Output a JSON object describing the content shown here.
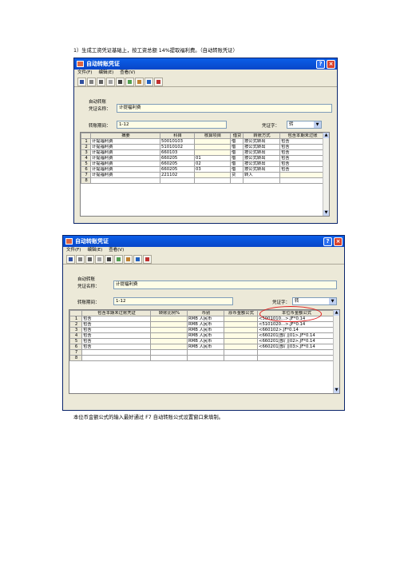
{
  "captions": {
    "top": "1）生成工资凭证基础上，按工资总额 14%提取福利费。（自动转账凭证）",
    "bottom": "本位币金额公式的输入最好通过 F7 自动转账公式设置窗口来填制。"
  },
  "window1": {
    "title": "自动转账凭证",
    "menu": [
      "文件(F)",
      "编辑(E)",
      "查看(V)"
    ],
    "auto_label": "自动转账",
    "voucher_name_label": "凭证名称：",
    "voucher_name": "计提福利费",
    "period_label": "转账期间：",
    "period": "1-12",
    "voucher_type_label": "凭证字：",
    "voucher_type": "转",
    "columns": [
      "",
      "摘要",
      "科目",
      "核算项目",
      "借贷",
      "转账方式",
      "包含本期未过账"
    ],
    "rows": [
      [
        "1",
        "计提福利费",
        "50010103",
        "",
        "借",
        "按公式转出",
        "包含"
      ],
      [
        "2",
        "计提福利费",
        "51010102",
        "",
        "借",
        "按公式转出",
        "包含"
      ],
      [
        "3",
        "计提福利费",
        "660103",
        "",
        "借",
        "按公式转出",
        "包含"
      ],
      [
        "4",
        "计提福利费",
        "660205",
        "01",
        "借",
        "按公式转出",
        "包含"
      ],
      [
        "5",
        "计提福利费",
        "660205",
        "02",
        "借",
        "按公式转出",
        "包含"
      ],
      [
        "6",
        "计提福利费",
        "660205",
        "03",
        "借",
        "按公式转出",
        "包含"
      ],
      [
        "7",
        "计提福利费",
        "221102",
        "",
        "贷",
        "转入",
        ""
      ],
      [
        "8",
        "",
        "",
        "",
        "",
        "",
        ""
      ]
    ]
  },
  "window2": {
    "title": "自动转账凭证",
    "menu": [
      "文件(F)",
      "编辑(E)",
      "查看(V)"
    ],
    "auto_label": "自动转账",
    "voucher_name_label": "凭证名称：",
    "voucher_name": "计提福利费",
    "period_label": "转账期间：",
    "period": "1-12",
    "voucher_type_label": "凭证字：",
    "voucher_type": "转",
    "columns": [
      "",
      "包含本期未过账凭证",
      "转账比例%",
      "币别",
      "原币金额公式",
      "本位币金额公式"
    ],
    "rows": [
      [
        "1",
        "包含",
        "",
        "RMB 人民币",
        "",
        "<5001010...>.JF*0.14"
      ],
      [
        "2",
        "包含",
        "",
        "RMB 人民币",
        "",
        "<5101020...>.JF*0.14"
      ],
      [
        "3",
        "包含",
        "",
        "RMB 人民币",
        "",
        "<660102>.JF*0.14"
      ],
      [
        "4",
        "包含",
        "",
        "RMB 人民币",
        "",
        "<660201|部门|01>.JF*0.14"
      ],
      [
        "5",
        "包含",
        "",
        "RMB 人民币",
        "",
        "<660201|部门|02>.JF*0.14"
      ],
      [
        "6",
        "包含",
        "",
        "RMB 人民币",
        "",
        "<660201|部门|03>.JF*0.14"
      ],
      [
        "7",
        "",
        "",
        "",
        "",
        ""
      ],
      [
        "8",
        "",
        "",
        "",
        "",
        ""
      ]
    ]
  },
  "colors": {
    "titlebar": "#0a5ee8",
    "highlight_ring": "#e02020",
    "input_bg": "#fffde6"
  }
}
